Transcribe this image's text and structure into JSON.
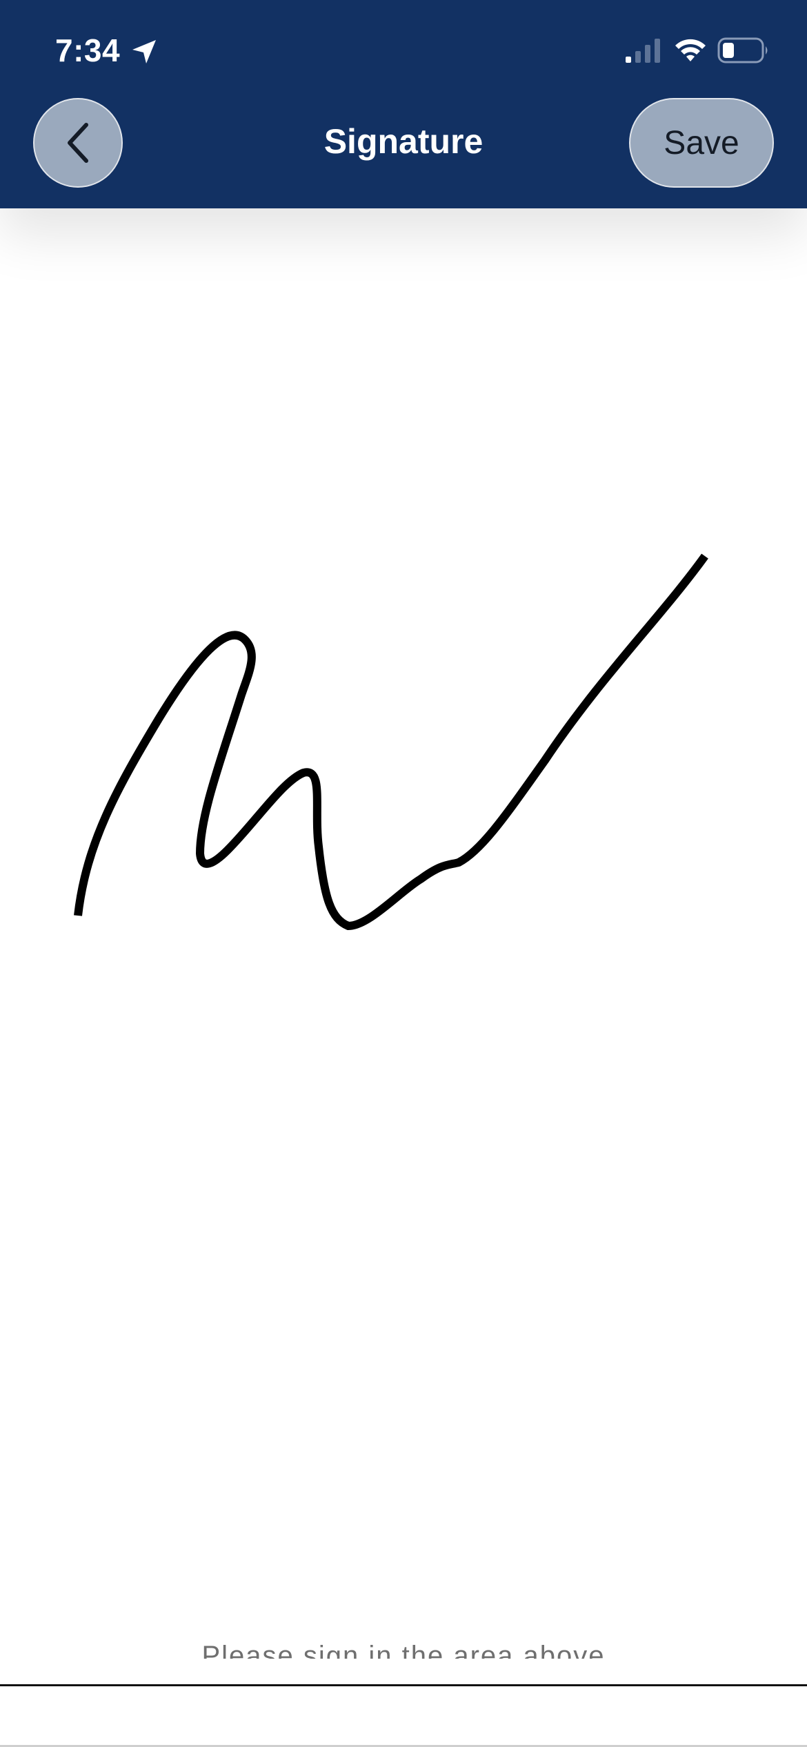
{
  "status_bar": {
    "time": "7:34",
    "icons": [
      "location-arrow-icon",
      "cellular-signal-icon",
      "wifi-icon",
      "battery-icon"
    ]
  },
  "header": {
    "title": "Signature",
    "back_icon": "chevron-left-icon",
    "save_label": "Save",
    "background_color": "#123163",
    "button_color": "#9aa9bd"
  },
  "signature_pad": {
    "hint_text": "Please sign in the area above",
    "stroke_color": "#000000"
  }
}
